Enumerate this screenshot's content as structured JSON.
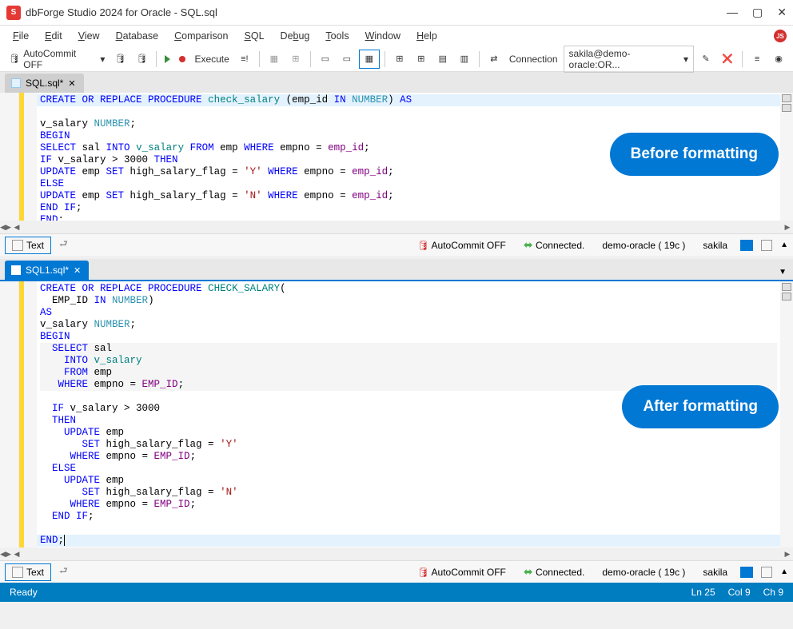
{
  "window": {
    "title": "dbForge Studio 2024 for Oracle - SQL.sql"
  },
  "menu": [
    "File",
    "Edit",
    "View",
    "Database",
    "Comparison",
    "SQL",
    "Debug",
    "Tools",
    "Window",
    "Help"
  ],
  "toolbar": {
    "autocommit": "AutoCommit OFF",
    "execute": "Execute",
    "connection_label": "Connection",
    "connection_value": "sakila@demo-oracle:OR..."
  },
  "tabs": {
    "tab1": "SQL.sql*",
    "tab2": "SQL1.sql*"
  },
  "badges": {
    "before": "Before formatting",
    "after": "After formatting"
  },
  "editor1_lines": [
    "CREATE OR REPLACE PROCEDURE check_salary (emp_id IN NUMBER) AS",
    "v_salary NUMBER;",
    "BEGIN",
    "SELECT sal INTO v_salary FROM emp WHERE empno = emp_id;",
    "IF v_salary > 3000 THEN",
    "UPDATE emp SET high_salary_flag = 'Y' WHERE empno = emp_id;",
    "ELSE",
    "UPDATE emp SET high_salary_flag = 'N' WHERE empno = emp_id;",
    "END IF;",
    "END;"
  ],
  "editor2_lines": [
    "CREATE OR REPLACE PROCEDURE CHECK_SALARY(",
    "  EMP_ID IN NUMBER)",
    "AS",
    "v_salary NUMBER;",
    "BEGIN",
    "  SELECT sal",
    "    INTO v_salary",
    "    FROM emp",
    "   WHERE empno = EMP_ID;",
    "",
    "  IF v_salary > 3000",
    "  THEN",
    "    UPDATE emp",
    "       SET high_salary_flag = 'Y'",
    "     WHERE empno = EMP_ID;",
    "  ELSE",
    "    UPDATE emp",
    "       SET high_salary_flag = 'N'",
    "     WHERE empno = EMP_ID;",
    "  END IF;",
    "",
    "END;"
  ],
  "footer": {
    "text_btn": "Text",
    "autocommit": "AutoCommit OFF",
    "connected": "Connected.",
    "server": "demo-oracle ( 19c )",
    "schema": "sakila"
  },
  "statusbar": {
    "ready": "Ready",
    "ln": "Ln 25",
    "col": "Col 9",
    "ch": "Ch 9"
  }
}
